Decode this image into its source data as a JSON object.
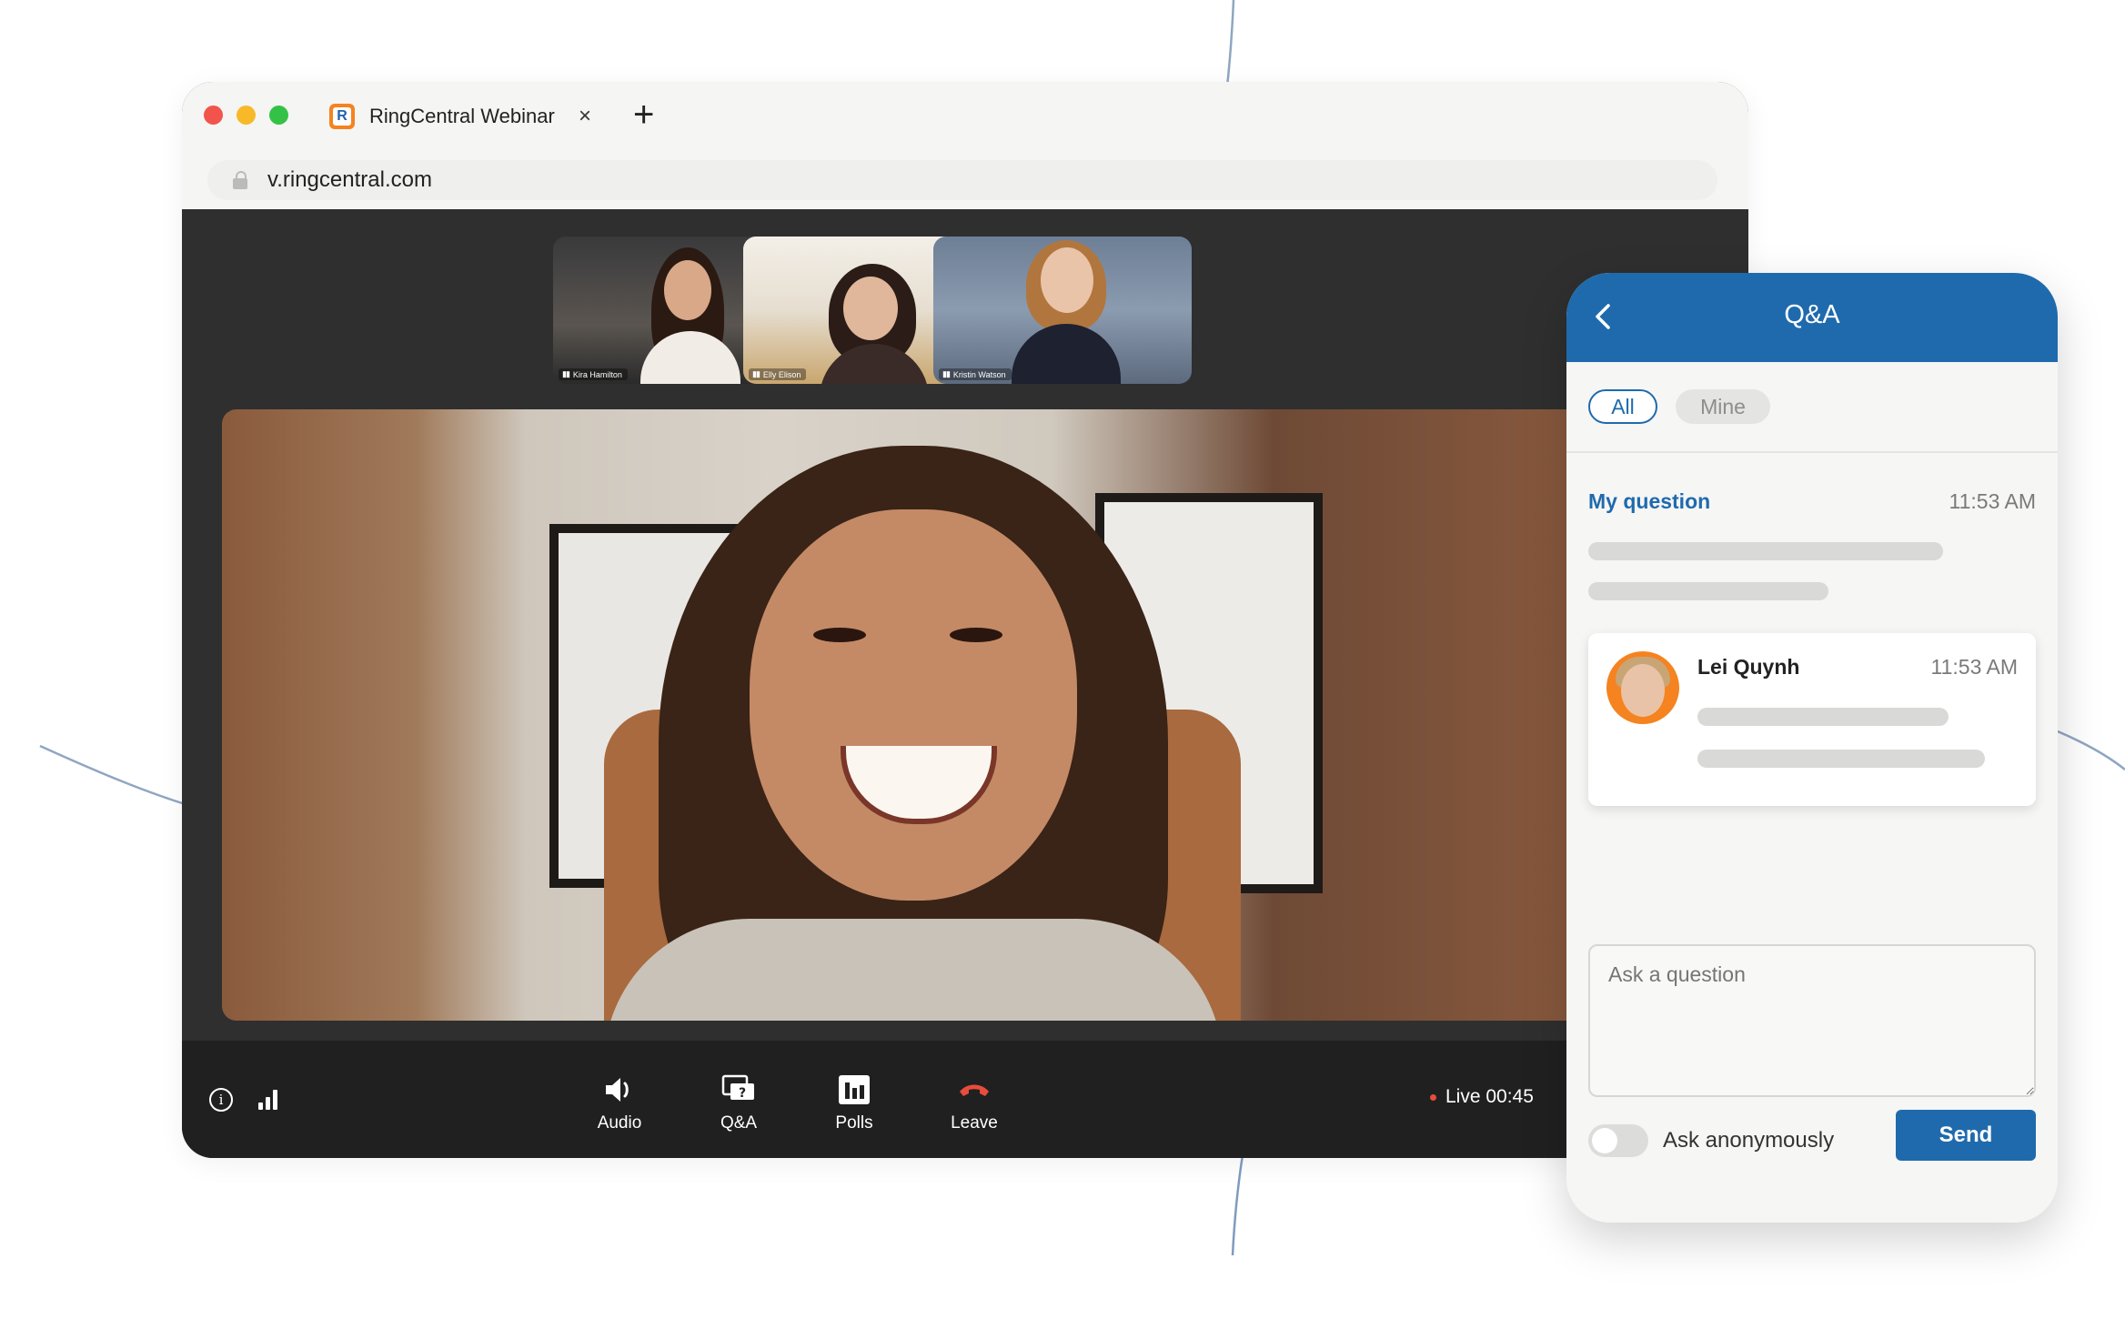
{
  "browser": {
    "tab_title": "RingCentral Webinar",
    "tab_close": "×",
    "new_tab": "+",
    "url": "v.ringcentral.com",
    "favicon_letter": "R"
  },
  "participants": [
    {
      "name": "Kira Hamilton"
    },
    {
      "name": "Elly Elison"
    },
    {
      "name": "Kristin Watson"
    }
  ],
  "controls": {
    "info": "i",
    "audio_label": "Audio",
    "qa_label": "Q&A",
    "polls_label": "Polls",
    "leave_label": "Leave",
    "live_status": "Live 00:45",
    "leave_color": "#e84c3d"
  },
  "qa": {
    "title": "Q&A",
    "filters": {
      "all": "All",
      "mine": "Mine"
    },
    "my_question": {
      "label": "My question",
      "time": "11:53 AM"
    },
    "reply": {
      "name": "Lei Quynh",
      "time": "11:53 AM"
    },
    "input_placeholder": "Ask a question",
    "anonymous_label": "Ask anonymously",
    "send_label": "Send",
    "accent_color": "#1f6aad"
  }
}
